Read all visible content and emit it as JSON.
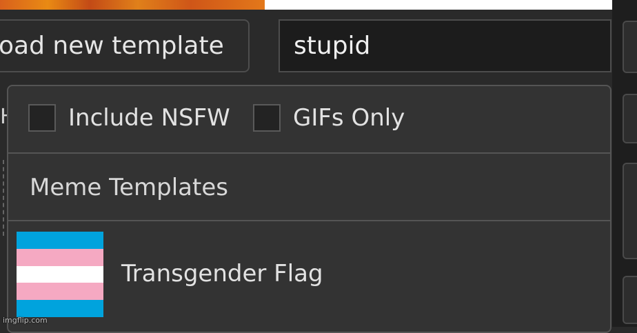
{
  "toolbar": {
    "upload_label": "oad new template",
    "search_value": "stupid"
  },
  "filters": {
    "nsfw_label": "Include NSFW",
    "gifs_label": "GIFs Only"
  },
  "results": {
    "section_title": "Meme Templates",
    "items": [
      {
        "label": "Transgender Flag",
        "flag_colors": [
          "#00a3dd",
          "#f5a9c2",
          "#ffffff",
          "#f5a9c2",
          "#00a3dd"
        ]
      }
    ]
  },
  "left_hint": "H",
  "watermark": "imgflip.com"
}
